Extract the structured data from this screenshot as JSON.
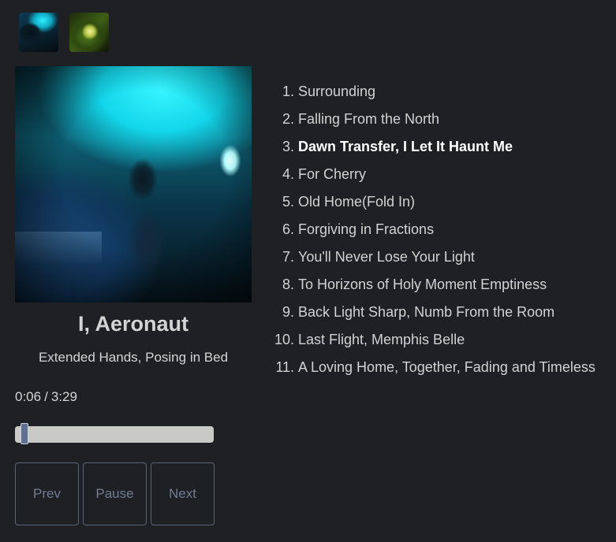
{
  "thumbnails": [
    {
      "name": "cover-thumbnail-1"
    },
    {
      "name": "cover-thumbnail-2"
    }
  ],
  "player": {
    "song_title": "I, Aeronaut",
    "album": "Extended Hands, Posing in Bed",
    "current_time": "0:06",
    "duration": "3:29",
    "progress_fraction": 0.029
  },
  "controls": {
    "prev_label": "Prev",
    "pause_label": "Pause",
    "next_label": "Next"
  },
  "tracklist": {
    "active_index": 2,
    "tracks": [
      {
        "num": "1.",
        "title": "Surrounding"
      },
      {
        "num": "2.",
        "title": "Falling From the North"
      },
      {
        "num": "3.",
        "title": "Dawn Transfer, I Let It Haunt Me"
      },
      {
        "num": "4.",
        "title": "For Cherry"
      },
      {
        "num": "5.",
        "title": "Old Home(Fold In)"
      },
      {
        "num": "6.",
        "title": "Forgiving in Fractions"
      },
      {
        "num": "7.",
        "title": "You'll Never Lose Your Light"
      },
      {
        "num": "8.",
        "title": "To Horizons of Holy Moment Emptiness"
      },
      {
        "num": "9.",
        "title": "Back Light Sharp, Numb From the Room"
      },
      {
        "num": "10.",
        "title": "Last Flight, Memphis Belle"
      },
      {
        "num": "11.",
        "title": "A Loving Home, Together, Fading and Timeless"
      }
    ]
  }
}
